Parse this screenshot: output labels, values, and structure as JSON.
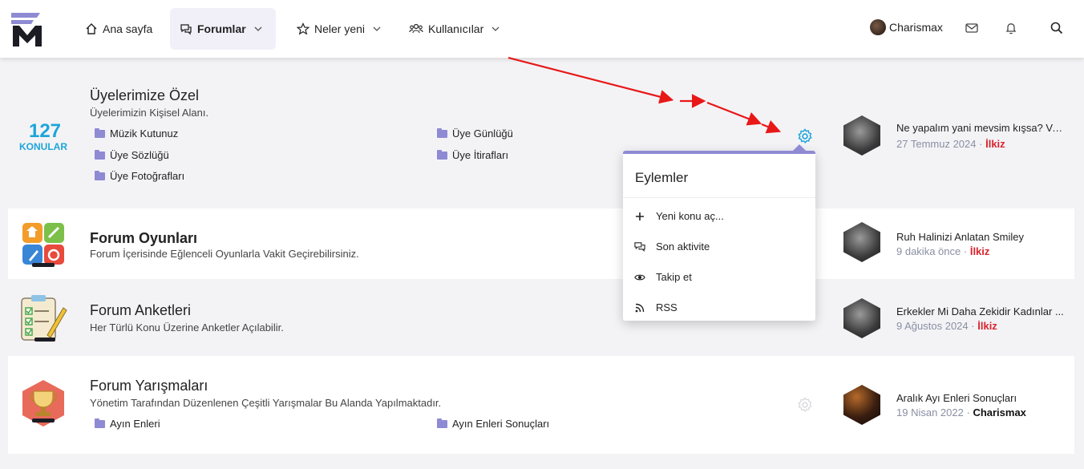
{
  "nav": {
    "home": "Ana sayfa",
    "forums": "Forumlar",
    "whats_new": "Neler yeni",
    "members": "Kullanıcılar",
    "username": "Charismax"
  },
  "nodes": [
    {
      "title": "Üyelerimize Özel",
      "desc": "Üyelerimizin Kişisel Alanı.",
      "stat_num": "127",
      "stat_label": "KONULAR",
      "subs": [
        "Müzik Kutunuz",
        "Üye Günlüğü",
        "Üye Sözlüğü",
        "Üye İtirafları",
        "Üye Fotoğrafları"
      ],
      "last_title": "Ne yapalım yani mevsim kışsa? Vaz...",
      "last_date": "27 Temmuz 2024",
      "last_user": "İlkiz"
    },
    {
      "title": "Forum Oyunları",
      "desc": "Forum İçerisinde Eğlenceli Oyunlarla Vakit Geçirebilirsiniz.",
      "last_title": "Ruh Halinizi Anlatan Smiley",
      "last_date": "9 dakika önce",
      "last_user": "İlkiz"
    },
    {
      "title": "Forum Anketleri",
      "desc": "Her Türlü Konu Üzerine Anketler Açılabilir.",
      "last_title": "Erkekler Mi Daha Zekidir Kadınlar ...",
      "last_date": "9 Ağustos 2024",
      "last_user": "İlkiz"
    },
    {
      "title": "Forum Yarışmaları",
      "desc": "Yönetim Tarafından Düzenlenen Çeşitli Yarışmalar Bu Alanda Yapılmaktadır.",
      "subs": [
        "Ayın Enleri",
        "Ayın Enleri Sonuçları"
      ],
      "last_title": "Aralık Ayı Enleri Sonuçları",
      "last_date": "19 Nisan 2022",
      "last_user": "Charismax"
    }
  ],
  "menu": {
    "heading": "Eylemler",
    "items": [
      "Yeni konu aç...",
      "Son aktivite",
      "Takip et",
      "RSS"
    ]
  },
  "sep": "·",
  "colors": {
    "accent": "#8e8ad3",
    "stat": "#1ea5d8",
    "user_red": "#d9232d",
    "gear_active": "#1ea5d8"
  }
}
